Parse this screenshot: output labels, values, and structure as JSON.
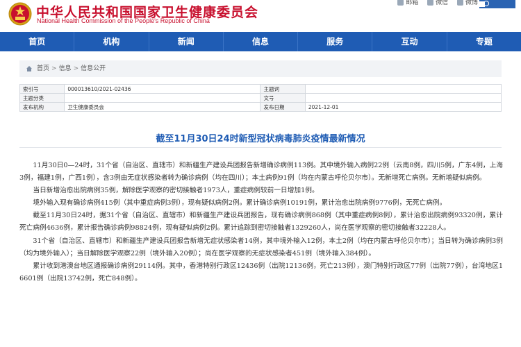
{
  "header": {
    "title": "中华人民共和国国家卫生健康委员会",
    "subtitle": "National Health Commission of the People's Republic of China",
    "top_links": [
      "邮箱",
      "微信",
      "微博"
    ],
    "colors": {
      "brand_red": "#c8102e",
      "nav_blue": "#1f5cb4"
    }
  },
  "nav": {
    "items": [
      "首页",
      "机构",
      "新闻",
      "信息",
      "服务",
      "互动",
      "专题"
    ]
  },
  "breadcrumb": {
    "home": "首页",
    "items": [
      "信息",
      "信息公开"
    ],
    "separator": ">"
  },
  "meta": {
    "index_label": "索引号",
    "index_value": "000013610/2021-02436",
    "subject_label": "主题词",
    "subject_value": "",
    "category_label": "主题分类",
    "category_value": "",
    "docnum_label": "文号",
    "docnum_value": "",
    "org_label": "发布机构",
    "org_value": "卫生健康委员会",
    "date_label": "发布日期",
    "date_value": "2021-12-01"
  },
  "article": {
    "title": "截至11月30日24时新型冠状病毒肺炎疫情最新情况",
    "paragraphs": [
      "11月30日0—24时，31个省（自治区、直辖市）和新疆生产建设兵团报告新增确诊病例113例。其中境外输入病例22例（云南8例，四川5例，广东4例，上海3例，福建1例，广西1例），含3例由无症状感染者转为确诊病例（均在四川）；本土病例91例（均在内蒙古呼伦贝尔市）。无新增死亡病例。无新增疑似病例。",
      "当日新增治愈出院病例35例，解除医学观察的密切接触者1973人，重症病例较前一日增加1例。",
      "境外输入现有确诊病例415例（其中重症病例3例），现有疑似病例2例。累计确诊病例10191例，累计治愈出院病例9776例，无死亡病例。",
      "截至11月30日24时，据31个省（自治区、直辖市）和新疆生产建设兵团报告，现有确诊病例868例（其中重症病例8例），累计治愈出院病例93320例，累计死亡病例4636例，累计报告确诊病例98824例，现有疑似病例2例。累计追踪到密切接触者1329260人，尚在医学观察的密切接触者32228人。",
      "31个省（自治区、直辖市）和新疆生产建设兵团报告新增无症状感染者14例，其中境外输入12例，本土2例（均在内蒙古呼伦贝尔市）；当日转为确诊病例3例（均为境外输入）；当日解除医学观察22例（境外输入20例）；尚在医学观察的无症状感染者451例（境外输入384例）。",
      "累计收到港澳台地区通报确诊病例29114例。其中，香港特别行政区12436例（出院12136例，死亡213例），澳门特别行政区77例（出院77例），台湾地区16601例（出院13742例，死亡848例）。"
    ]
  }
}
